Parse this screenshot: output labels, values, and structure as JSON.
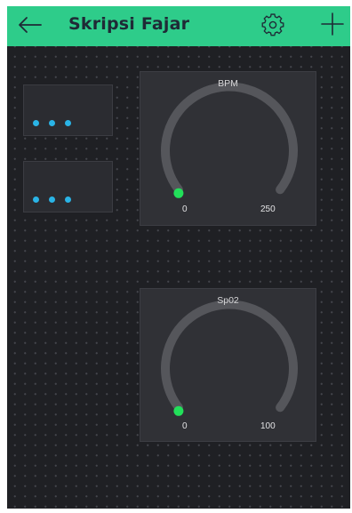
{
  "header": {
    "title": "Skripsi Fajar",
    "back_icon": "arrow-left-icon",
    "settings_icon": "gear-icon",
    "add_icon": "plus-icon",
    "color": "#2ecc8a"
  },
  "widgets": {
    "small": [
      {
        "name": "widget-1",
        "dots_color": "#2ab4e6"
      },
      {
        "name": "widget-2",
        "dots_color": "#2ab4e6"
      }
    ],
    "gauges": [
      {
        "title": "BPM",
        "min": "0",
        "max": "250",
        "value": 0,
        "indicator_color": "#22e05a"
      },
      {
        "title": "Sp02",
        "min": "0",
        "max": "100",
        "value": 0,
        "indicator_color": "#22e05a"
      }
    ]
  },
  "colors": {
    "background": "#1f2024",
    "widget": "#303136",
    "arc": "#55565b"
  }
}
